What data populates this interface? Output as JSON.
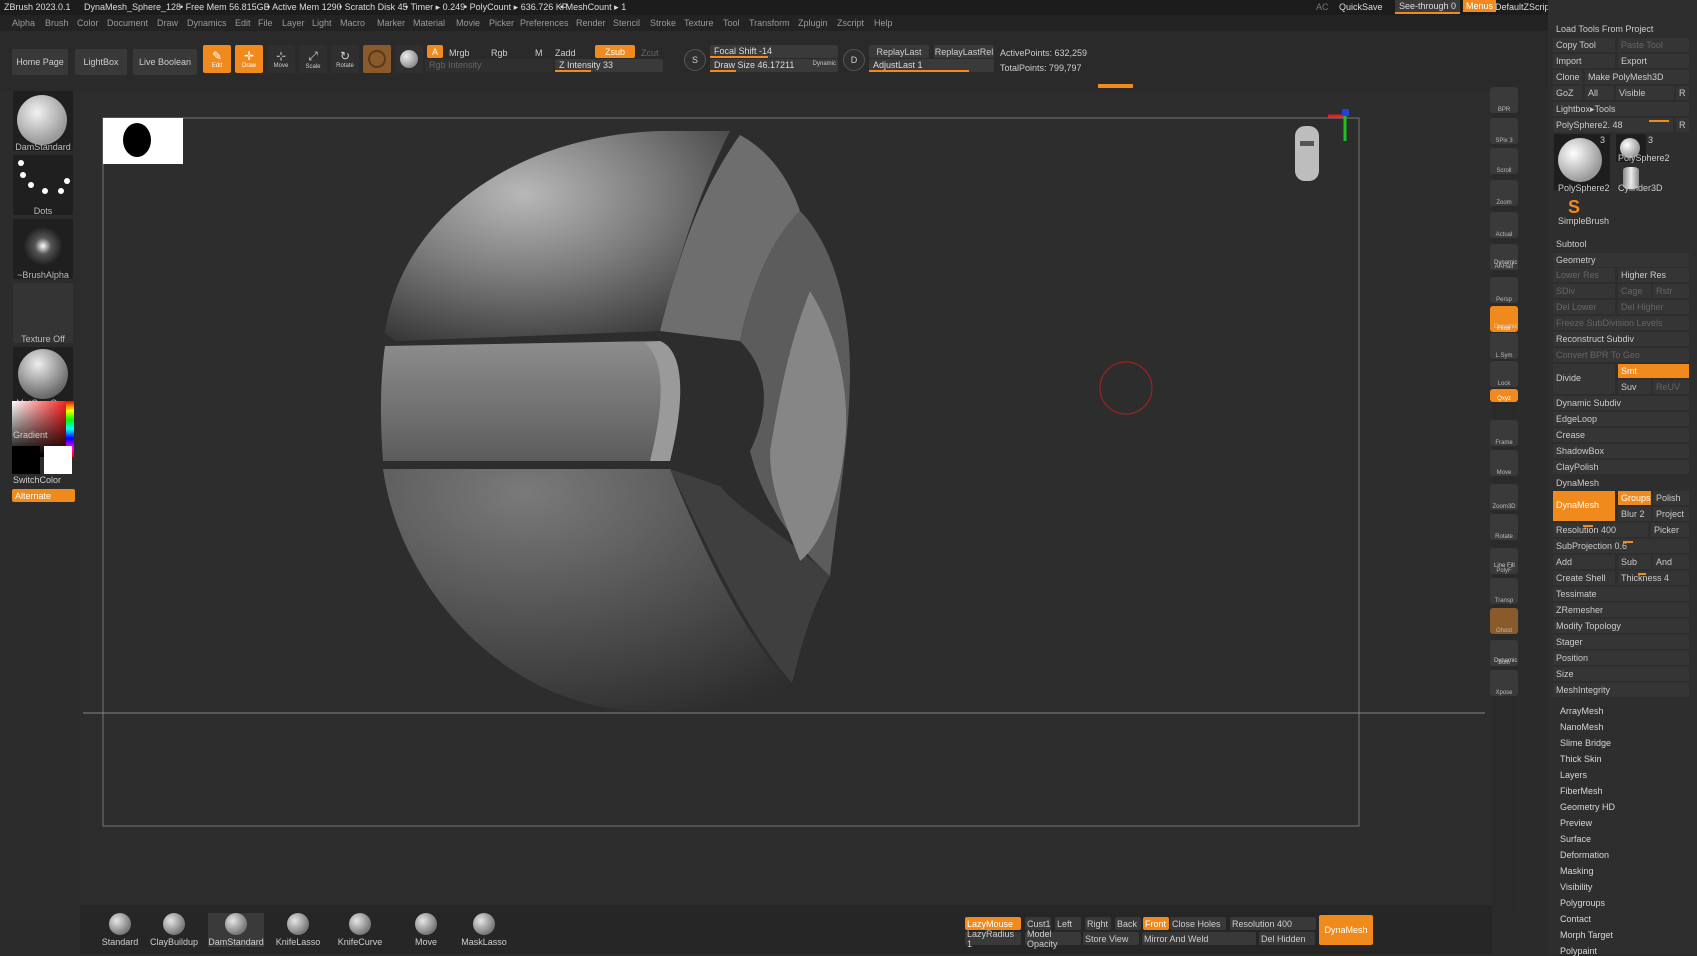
{
  "titlebar": {
    "app": "ZBrush 2023.0.1",
    "doc": "DynaMesh_Sphere_128",
    "free_mem": "• Free Mem 56.815GB",
    "active_mem": "• Active Mem 1290",
    "scratch": "• Scratch Disk 45",
    "timer": "• Timer ▸ 0.249",
    "polycount": "• PolyCount ▸ 636.726 KP",
    "meshcount": "• MeshCount ▸ 1",
    "ac": "AC",
    "quicksave": "QuickSave",
    "see_through": "See-through   0",
    "menus": "Menus",
    "script": "DefaultZScript"
  },
  "menus": [
    "Alpha",
    "Brush",
    "Color",
    "Document",
    "Draw",
    "Dynamics",
    "Edit",
    "File",
    "Layer",
    "Light",
    "Macro",
    "Marker",
    "Material",
    "Movie",
    "Picker",
    "Preferences",
    "Render",
    "Stencil",
    "Stroke",
    "Texture",
    "Tool",
    "Transform",
    "Zplugin",
    "Zscript",
    "Help"
  ],
  "shelf": {
    "home_page": "Home Page",
    "lightbox": "LightBox",
    "live_boolean": "Live Boolean",
    "edit": "Edit",
    "draw": "Draw",
    "move": "Move",
    "scale": "Scale",
    "rotate": "Rotate",
    "a": "A",
    "mrgb": "Mrgb",
    "rgb": "Rgb",
    "m": "M",
    "zadd": "Zadd",
    "zsub": "Zsub",
    "zcut": "Zcut",
    "rgb_intensity": "Rgb Intensity",
    "z_intensity": "Z Intensity 33",
    "focal_shift": "Focal Shift -14",
    "draw_size": "Draw Size 46.17211",
    "dynamic": "Dynamic",
    "replay_last": "ReplayLast",
    "replay_last_rel": "ReplayLastRel",
    "adjust_last": "AdjustLast 1",
    "active_points": "ActivePoints: 632,259",
    "total_points": "TotalPoints: 799,797",
    "s": "S",
    "d": "D"
  },
  "leftpanel": {
    "brush": "DamStandard",
    "stroke": "Dots",
    "alpha": "~BrushAlpha",
    "texture": "Texture Off",
    "material": "MatCap Gray",
    "gradient": "Gradient",
    "switchcolor": "SwitchColor",
    "alternate": "Alternate"
  },
  "rightstrip": [
    "BPR",
    "SPix 3",
    "Scroll",
    "Zoom",
    "Actual",
    "AAHalf",
    "Persp",
    "Floor",
    "L.Sym",
    "Lock",
    "Qxyz",
    "Frame",
    "Move",
    "Zoom3D",
    "Rotate",
    "PolyF",
    "Transp",
    "Ghost",
    "Solo",
    "Xpose"
  ],
  "rightstrip_labels": {
    "dynamic1": "Dynamic",
    "dynamic2": "Dynamic",
    "dynamic3": "Dynamic",
    "linefill": "Line Fill"
  },
  "tool": {
    "load_tools": "Load Tools From Project",
    "copy_tool": "Copy Tool",
    "paste_tool": "Paste Tool",
    "import": "Import",
    "export": "Export",
    "clone": "Clone",
    "make_polymesh": "Make PolyMesh3D",
    "goz": "GoZ",
    "all": "All",
    "visible": "Visible",
    "r": "R",
    "lightbox_tools": "Lightbox▸Tools",
    "polysphere_slider": "PolySphere2. 48",
    "thumbs": [
      "PolySphere2",
      "PolySphere2",
      "Cylinder3D",
      "SimpleBrush"
    ],
    "thumb_counts": [
      "3",
      "3"
    ],
    "subtool": "Subtool",
    "geometry": "Geometry",
    "lower_res": "Lower Res",
    "higher_res": "Higher Res",
    "sdiv": "SDiv",
    "cage": "Cage",
    "rstr": "Rstr",
    "del_lower": "Del Lower",
    "del_higher": "Del Higher",
    "freeze": "Freeze SubDivision Levels",
    "reconstruct": "Reconstruct Subdiv",
    "convert_bpr": "Convert BPR To Geo",
    "divide": "Divide",
    "smt": "Smt",
    "suv": "Suv",
    "reuv": "ReUV",
    "dynamic_subdiv": "Dynamic Subdiv",
    "edgeloop": "EdgeLoop",
    "crease": "Crease",
    "shadowbox": "ShadowBox",
    "claypolish": "ClayPolish",
    "dynamesh_header": "DynaMesh",
    "dynamesh_btn": "DynaMesh",
    "groups": "Groups",
    "polish": "Polish",
    "blur": "Blur 2",
    "project": "Project",
    "resolution": "Resolution 400",
    "picker": "Picker",
    "subprojection": "SubProjection 0.6",
    "add": "Add",
    "sub": "Sub",
    "and": "And",
    "create_shell": "Create Shell",
    "thickness": "Thickness 4",
    "tessimate": "Tessimate",
    "zremesher": "ZRemesher",
    "modify_topology": "Modify Topology",
    "stager": "Stager",
    "position": "Position",
    "size": "Size",
    "meshintegrity": "MeshIntegrity",
    "sections": [
      "ArrayMesh",
      "NanoMesh",
      "Slime Bridge",
      "Thick Skin",
      "Layers",
      "FiberMesh",
      "Geometry HD",
      "Preview",
      "Surface",
      "Deformation",
      "Masking",
      "Visibility",
      "Polygroups",
      "Contact",
      "Morph Target",
      "Polypaint"
    ]
  },
  "bottom": {
    "brushes": [
      "Standard",
      "ClayBuildup",
      "DamStandard",
      "KnifeLasso",
      "KnifeCurve",
      "Move",
      "MaskLasso"
    ],
    "lazymouse": "LazyMouse",
    "cust1": "Cust1",
    "left": "Left",
    "right": "Right",
    "back": "Back",
    "front": "Front",
    "close_holes": "Close Holes",
    "resolution": "Resolution 400",
    "lazyradius": "LazyRadius 1",
    "model_opacity": "Model Opacity",
    "store_view": "Store View",
    "mirror_weld": "Mirror And Weld",
    "del_hidden": "Del Hidden",
    "dynamesh": "DynaMesh"
  },
  "colors": {
    "accent": "#f08a1d",
    "bg": "#2b2b2b",
    "panel": "#2e2e2e"
  }
}
